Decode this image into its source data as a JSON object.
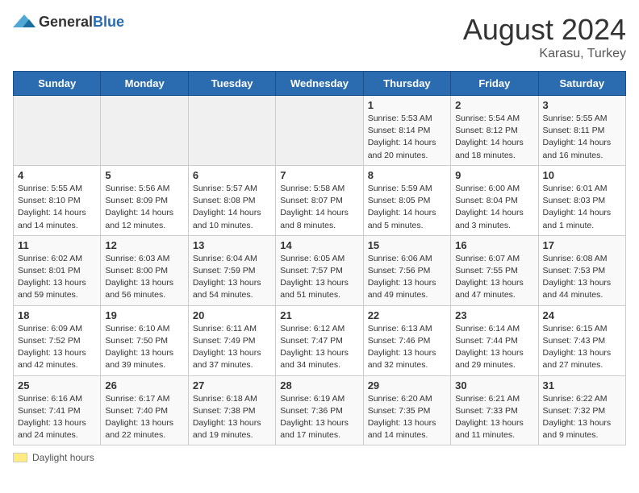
{
  "header": {
    "logo_general": "General",
    "logo_blue": "Blue",
    "month_year": "August 2024",
    "location": "Karasu, Turkey"
  },
  "footer": {
    "label": "Daylight hours"
  },
  "days_of_week": [
    "Sunday",
    "Monday",
    "Tuesday",
    "Wednesday",
    "Thursday",
    "Friday",
    "Saturday"
  ],
  "weeks": [
    [
      {
        "day": "",
        "empty": true
      },
      {
        "day": "",
        "empty": true
      },
      {
        "day": "",
        "empty": true
      },
      {
        "day": "",
        "empty": true
      },
      {
        "day": "1",
        "sunrise": "Sunrise: 5:53 AM",
        "sunset": "Sunset: 8:14 PM",
        "daylight": "Daylight: 14 hours and 20 minutes."
      },
      {
        "day": "2",
        "sunrise": "Sunrise: 5:54 AM",
        "sunset": "Sunset: 8:12 PM",
        "daylight": "Daylight: 14 hours and 18 minutes."
      },
      {
        "day": "3",
        "sunrise": "Sunrise: 5:55 AM",
        "sunset": "Sunset: 8:11 PM",
        "daylight": "Daylight: 14 hours and 16 minutes."
      }
    ],
    [
      {
        "day": "4",
        "sunrise": "Sunrise: 5:55 AM",
        "sunset": "Sunset: 8:10 PM",
        "daylight": "Daylight: 14 hours and 14 minutes."
      },
      {
        "day": "5",
        "sunrise": "Sunrise: 5:56 AM",
        "sunset": "Sunset: 8:09 PM",
        "daylight": "Daylight: 14 hours and 12 minutes."
      },
      {
        "day": "6",
        "sunrise": "Sunrise: 5:57 AM",
        "sunset": "Sunset: 8:08 PM",
        "daylight": "Daylight: 14 hours and 10 minutes."
      },
      {
        "day": "7",
        "sunrise": "Sunrise: 5:58 AM",
        "sunset": "Sunset: 8:07 PM",
        "daylight": "Daylight: 14 hours and 8 minutes."
      },
      {
        "day": "8",
        "sunrise": "Sunrise: 5:59 AM",
        "sunset": "Sunset: 8:05 PM",
        "daylight": "Daylight: 14 hours and 5 minutes."
      },
      {
        "day": "9",
        "sunrise": "Sunrise: 6:00 AM",
        "sunset": "Sunset: 8:04 PM",
        "daylight": "Daylight: 14 hours and 3 minutes."
      },
      {
        "day": "10",
        "sunrise": "Sunrise: 6:01 AM",
        "sunset": "Sunset: 8:03 PM",
        "daylight": "Daylight: 14 hours and 1 minute."
      }
    ],
    [
      {
        "day": "11",
        "sunrise": "Sunrise: 6:02 AM",
        "sunset": "Sunset: 8:01 PM",
        "daylight": "Daylight: 13 hours and 59 minutes."
      },
      {
        "day": "12",
        "sunrise": "Sunrise: 6:03 AM",
        "sunset": "Sunset: 8:00 PM",
        "daylight": "Daylight: 13 hours and 56 minutes."
      },
      {
        "day": "13",
        "sunrise": "Sunrise: 6:04 AM",
        "sunset": "Sunset: 7:59 PM",
        "daylight": "Daylight: 13 hours and 54 minutes."
      },
      {
        "day": "14",
        "sunrise": "Sunrise: 6:05 AM",
        "sunset": "Sunset: 7:57 PM",
        "daylight": "Daylight: 13 hours and 51 minutes."
      },
      {
        "day": "15",
        "sunrise": "Sunrise: 6:06 AM",
        "sunset": "Sunset: 7:56 PM",
        "daylight": "Daylight: 13 hours and 49 minutes."
      },
      {
        "day": "16",
        "sunrise": "Sunrise: 6:07 AM",
        "sunset": "Sunset: 7:55 PM",
        "daylight": "Daylight: 13 hours and 47 minutes."
      },
      {
        "day": "17",
        "sunrise": "Sunrise: 6:08 AM",
        "sunset": "Sunset: 7:53 PM",
        "daylight": "Daylight: 13 hours and 44 minutes."
      }
    ],
    [
      {
        "day": "18",
        "sunrise": "Sunrise: 6:09 AM",
        "sunset": "Sunset: 7:52 PM",
        "daylight": "Daylight: 13 hours and 42 minutes."
      },
      {
        "day": "19",
        "sunrise": "Sunrise: 6:10 AM",
        "sunset": "Sunset: 7:50 PM",
        "daylight": "Daylight: 13 hours and 39 minutes."
      },
      {
        "day": "20",
        "sunrise": "Sunrise: 6:11 AM",
        "sunset": "Sunset: 7:49 PM",
        "daylight": "Daylight: 13 hours and 37 minutes."
      },
      {
        "day": "21",
        "sunrise": "Sunrise: 6:12 AM",
        "sunset": "Sunset: 7:47 PM",
        "daylight": "Daylight: 13 hours and 34 minutes."
      },
      {
        "day": "22",
        "sunrise": "Sunrise: 6:13 AM",
        "sunset": "Sunset: 7:46 PM",
        "daylight": "Daylight: 13 hours and 32 minutes."
      },
      {
        "day": "23",
        "sunrise": "Sunrise: 6:14 AM",
        "sunset": "Sunset: 7:44 PM",
        "daylight": "Daylight: 13 hours and 29 minutes."
      },
      {
        "day": "24",
        "sunrise": "Sunrise: 6:15 AM",
        "sunset": "Sunset: 7:43 PM",
        "daylight": "Daylight: 13 hours and 27 minutes."
      }
    ],
    [
      {
        "day": "25",
        "sunrise": "Sunrise: 6:16 AM",
        "sunset": "Sunset: 7:41 PM",
        "daylight": "Daylight: 13 hours and 24 minutes."
      },
      {
        "day": "26",
        "sunrise": "Sunrise: 6:17 AM",
        "sunset": "Sunset: 7:40 PM",
        "daylight": "Daylight: 13 hours and 22 minutes."
      },
      {
        "day": "27",
        "sunrise": "Sunrise: 6:18 AM",
        "sunset": "Sunset: 7:38 PM",
        "daylight": "Daylight: 13 hours and 19 minutes."
      },
      {
        "day": "28",
        "sunrise": "Sunrise: 6:19 AM",
        "sunset": "Sunset: 7:36 PM",
        "daylight": "Daylight: 13 hours and 17 minutes."
      },
      {
        "day": "29",
        "sunrise": "Sunrise: 6:20 AM",
        "sunset": "Sunset: 7:35 PM",
        "daylight": "Daylight: 13 hours and 14 minutes."
      },
      {
        "day": "30",
        "sunrise": "Sunrise: 6:21 AM",
        "sunset": "Sunset: 7:33 PM",
        "daylight": "Daylight: 13 hours and 11 minutes."
      },
      {
        "day": "31",
        "sunrise": "Sunrise: 6:22 AM",
        "sunset": "Sunset: 7:32 PM",
        "daylight": "Daylight: 13 hours and 9 minutes."
      }
    ]
  ]
}
